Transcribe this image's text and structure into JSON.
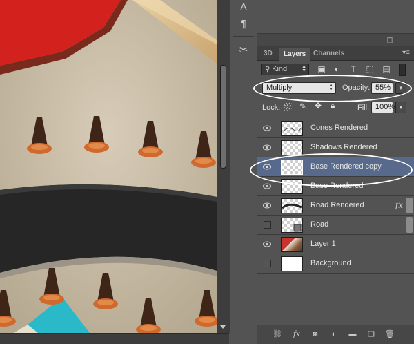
{
  "tools": {
    "type_glyph": "A",
    "paragraph_glyph": "¶",
    "tools_glyph": "✂"
  },
  "tabs": [
    {
      "label": "3D"
    },
    {
      "label": "Layers"
    },
    {
      "label": "Channels"
    }
  ],
  "filter": {
    "kind_label": "Kind",
    "icons": [
      "image-filter-icon",
      "adjustment-filter-icon",
      "type-filter-icon",
      "shape-filter-icon",
      "smart-object-filter-icon"
    ]
  },
  "blend": {
    "mode": "Multiply",
    "opacity_label": "Opacity:",
    "opacity_value": "55%"
  },
  "lock": {
    "label": "Lock:",
    "fill_label": "Fill:",
    "fill_value": "100%"
  },
  "layers": [
    {
      "name": "Cones Rendered",
      "visible": true,
      "thumb": "transparent"
    },
    {
      "name": "Shadows Rendered",
      "visible": true,
      "thumb": "transparent"
    },
    {
      "name": "Base Rendered copy",
      "visible": true,
      "thumb": "transparent",
      "selected": true
    },
    {
      "name": "Base Rendered",
      "visible": true,
      "thumb": "transparent"
    },
    {
      "name": "Road Rendered",
      "visible": true,
      "thumb": "transparent",
      "fx": "fx"
    },
    {
      "name": "Road",
      "visible": false,
      "thumb": "transparent"
    },
    {
      "name": "Layer 1",
      "visible": true,
      "thumb": "photo"
    },
    {
      "name": "Background",
      "visible": false,
      "thumb": "white"
    }
  ],
  "bottom_bar": {
    "fx_label": "fx"
  },
  "colors": {
    "panel_bg": "#535353",
    "selected_row": "#586a8c",
    "highlight_ellipse": "#ffffff"
  }
}
